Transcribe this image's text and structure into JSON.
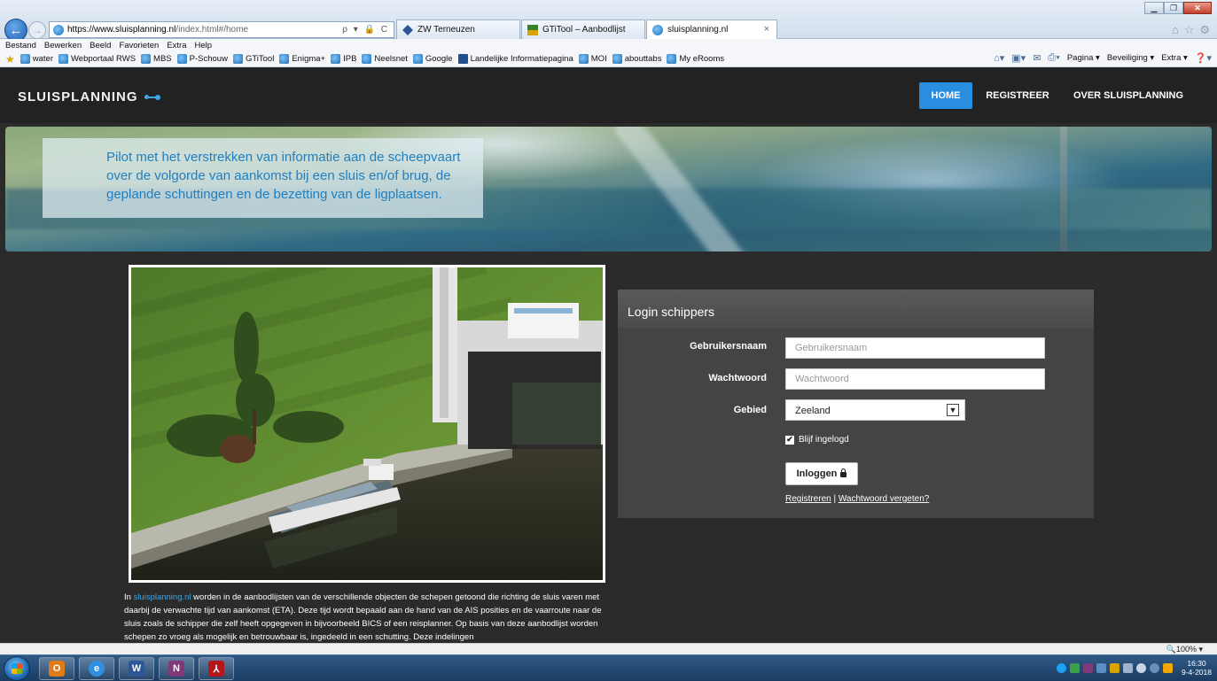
{
  "browser": {
    "url_host": "https://www.sluisplanning.nl",
    "url_rest": "/index.html#/home",
    "addr_tools": "ρ ▾ 🔒 C",
    "tabs": [
      {
        "label": "ZW Terneuzen"
      },
      {
        "label": "GTiTool – Aanbodlijst"
      },
      {
        "label": "sluisplanning.nl",
        "close": "×"
      }
    ],
    "menu": [
      "Bestand",
      "Bewerken",
      "Beeld",
      "Favorieten",
      "Extra",
      "Help"
    ],
    "favorites": [
      "water",
      "Webportaal RWS",
      "MBS",
      "P-Schouw",
      "GTiTool",
      "Enigma+",
      "IPB",
      "Neelsnet",
      "Google",
      "Landelijke Informatiepagina",
      "MOI",
      "abouttabs",
      "My eRooms"
    ],
    "command": {
      "pagina": "Pagina ▾",
      "beveiliging": "Beveiliging ▾",
      "extra": "Extra ▾"
    },
    "zoom": "🔍100%  ▾"
  },
  "site": {
    "brand": "SLUISPLANNING",
    "nav": {
      "home": "HOME",
      "register": "REGISTREER",
      "about": "OVER SLUISPLANNING"
    },
    "hero_text": "Pilot met het verstrekken van informatie aan de scheepvaart over de volgorde van aankomst bij een sluis en/of brug, de geplande schuttingen en de bezetting van de ligplaatsen.",
    "intro": {
      "prefix": "In ",
      "link": "sluisplanning.nl",
      "body": " worden in de aanbodlijsten van de verschillende objecten de schepen getoond die richting de sluis varen met daarbij de verwachte tijd van aankomst (ETA). Deze tijd wordt bepaald aan de hand van de AIS posities en de vaarroute naar de sluis zoals de schipper die zelf heeft opgegeven in bijvoorbeeld BICS of een reisplanner. Op basis van deze aanbodlijst worden schepen zo vroeg als mogelijk en betrouwbaar is, ingedeeld in een schutting. Deze indelingen"
    },
    "login": {
      "title": "Login schippers",
      "username_label": "Gebruikersnaam",
      "username_placeholder": "Gebruikersnaam",
      "password_label": "Wachtwoord",
      "password_placeholder": "Wachtwoord",
      "area_label": "Gebied",
      "area_value": "Zeeland",
      "remember_label": "Blijf ingelogd",
      "remember_checked": true,
      "submit_label": "Inloggen",
      "register_link": "Registreren",
      "separator": " | ",
      "forgot_link": "Wachtwoord vergeten?"
    }
  },
  "taskbar": {
    "time": "16:30",
    "date": "9-4-2018"
  },
  "colors": {
    "accent": "#2a8ee0",
    "link": "#3fa6e6",
    "hero_text": "#1f7fc0",
    "panel": "#444444",
    "page_bg": "#2b2b2b"
  }
}
